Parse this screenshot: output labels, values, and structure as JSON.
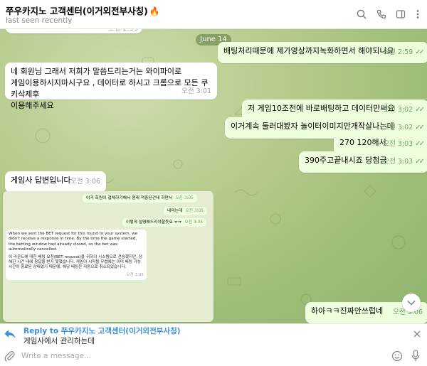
{
  "header": {
    "title": "쭈우카지노 고객센터(이거외전부사칭)",
    "title_emoji": "🔥",
    "status": "last seen recently"
  },
  "icons": [
    "search-icon",
    "phone-icon",
    "sidebar-icon",
    "more-icon",
    "reply-arrow-icon",
    "close-icon",
    "attach-icon",
    "emoji-icon",
    "microphone-icon",
    "chevron-down-icon",
    "check-icon"
  ],
  "colors": {
    "outgoing_bubble": "#eeffde",
    "incoming_bubble": "#ffffff",
    "accent": "#3a8fd8",
    "read_check": "#4fae4e"
  },
  "chat": {
    "top_partial_time": "오전 2:59",
    "date_divider": "June 14",
    "messages": [
      {
        "dir": "out",
        "text": "배팅처리때문에 제가영상까지녹화하면서 해야되나요",
        "time": "오전 2:59"
      },
      {
        "dir": "in",
        "lines": [
          "네 회원님 그래서 저희가 말씀드리는거는 와이파이로",
          "게임이용하시지마시구요 , 데이터로 하시고 크롬으로 모든 쿠키삭제후",
          "이용해주세요"
        ],
        "time": "오전 3:01"
      },
      {
        "dir": "out",
        "text": "저 게임10조전에 바로배팅하고 데이터만써요",
        "time": "오전 3:02"
      },
      {
        "dir": "out",
        "text": "이거계속 둘러대봤자 놀이터이미지만개작살나는데",
        "time": "오전 3:02"
      },
      {
        "dir": "out",
        "text": "270 120해서",
        "time": "오전 3:03"
      },
      {
        "dir": "out",
        "text": "390주고끝내시죠 당첨금",
        "time": "오전 3:03"
      },
      {
        "dir": "in",
        "text": "게임사 답변입니다",
        "time": "오전 3:06"
      },
      {
        "dir": "out",
        "text": "하아ㅋㅋ진짜안쓰럽네",
        "time": "오전 3:06"
      }
    ],
    "screenshot": {
      "mini_out": [
        {
          "text": "이거 회원이 접체하기해서 원래 적중된건데 하면서",
          "time": "오전 3:05"
        },
        {
          "text": "내미는데",
          "time": "오전 3:05"
        },
        {
          "text": "이렇게 설명해드리야할듯요 ㅠㅠ",
          "time": "오전 3:05"
        }
      ],
      "mini_in_en": "When we sent the BET request for this round to your system, we didn't receive a response in time. By the time the game started, the betting window had already closed, so the bet was automatically cancelled.",
      "mini_in_ko": "이 라운드에 대한 배팅 요청(BET request)을 귀하의 시스템으로 전송했지만, 정해진 시간 내에 응답을 받지 못했습니다. 게임이 시작될 무렵에는 이미 배팅 가능 시간이 종료된 상태였기 때문에, 해당 배팅은 자동으로 취소되었습니다.",
      "mini_in_time": "오전 3:05"
    }
  },
  "reply": {
    "label": "Reply to 쭈우카지노 고객센터(이거외전부사칭)",
    "text": "게임사에서 관리하는데"
  },
  "composer": {
    "placeholder": "Write a message..."
  }
}
